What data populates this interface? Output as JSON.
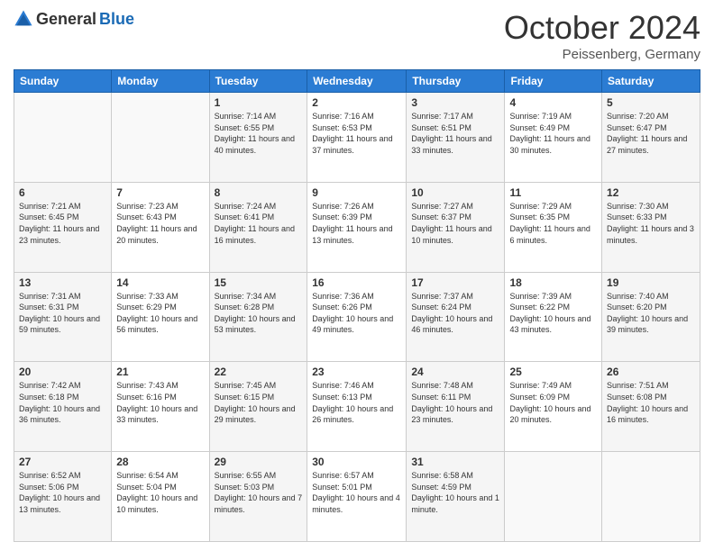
{
  "header": {
    "logo": {
      "general": "General",
      "blue": "Blue"
    },
    "title": "October 2024",
    "location": "Peissenberg, Germany"
  },
  "days_of_week": [
    "Sunday",
    "Monday",
    "Tuesday",
    "Wednesday",
    "Thursday",
    "Friday",
    "Saturday"
  ],
  "weeks": [
    [
      {
        "num": "",
        "sunrise": "",
        "sunset": "",
        "daylight": ""
      },
      {
        "num": "",
        "sunrise": "",
        "sunset": "",
        "daylight": ""
      },
      {
        "num": "1",
        "sunrise": "Sunrise: 7:14 AM",
        "sunset": "Sunset: 6:55 PM",
        "daylight": "Daylight: 11 hours and 40 minutes."
      },
      {
        "num": "2",
        "sunrise": "Sunrise: 7:16 AM",
        "sunset": "Sunset: 6:53 PM",
        "daylight": "Daylight: 11 hours and 37 minutes."
      },
      {
        "num": "3",
        "sunrise": "Sunrise: 7:17 AM",
        "sunset": "Sunset: 6:51 PM",
        "daylight": "Daylight: 11 hours and 33 minutes."
      },
      {
        "num": "4",
        "sunrise": "Sunrise: 7:19 AM",
        "sunset": "Sunset: 6:49 PM",
        "daylight": "Daylight: 11 hours and 30 minutes."
      },
      {
        "num": "5",
        "sunrise": "Sunrise: 7:20 AM",
        "sunset": "Sunset: 6:47 PM",
        "daylight": "Daylight: 11 hours and 27 minutes."
      }
    ],
    [
      {
        "num": "6",
        "sunrise": "Sunrise: 7:21 AM",
        "sunset": "Sunset: 6:45 PM",
        "daylight": "Daylight: 11 hours and 23 minutes."
      },
      {
        "num": "7",
        "sunrise": "Sunrise: 7:23 AM",
        "sunset": "Sunset: 6:43 PM",
        "daylight": "Daylight: 11 hours and 20 minutes."
      },
      {
        "num": "8",
        "sunrise": "Sunrise: 7:24 AM",
        "sunset": "Sunset: 6:41 PM",
        "daylight": "Daylight: 11 hours and 16 minutes."
      },
      {
        "num": "9",
        "sunrise": "Sunrise: 7:26 AM",
        "sunset": "Sunset: 6:39 PM",
        "daylight": "Daylight: 11 hours and 13 minutes."
      },
      {
        "num": "10",
        "sunrise": "Sunrise: 7:27 AM",
        "sunset": "Sunset: 6:37 PM",
        "daylight": "Daylight: 11 hours and 10 minutes."
      },
      {
        "num": "11",
        "sunrise": "Sunrise: 7:29 AM",
        "sunset": "Sunset: 6:35 PM",
        "daylight": "Daylight: 11 hours and 6 minutes."
      },
      {
        "num": "12",
        "sunrise": "Sunrise: 7:30 AM",
        "sunset": "Sunset: 6:33 PM",
        "daylight": "Daylight: 11 hours and 3 minutes."
      }
    ],
    [
      {
        "num": "13",
        "sunrise": "Sunrise: 7:31 AM",
        "sunset": "Sunset: 6:31 PM",
        "daylight": "Daylight: 10 hours and 59 minutes."
      },
      {
        "num": "14",
        "sunrise": "Sunrise: 7:33 AM",
        "sunset": "Sunset: 6:29 PM",
        "daylight": "Daylight: 10 hours and 56 minutes."
      },
      {
        "num": "15",
        "sunrise": "Sunrise: 7:34 AM",
        "sunset": "Sunset: 6:28 PM",
        "daylight": "Daylight: 10 hours and 53 minutes."
      },
      {
        "num": "16",
        "sunrise": "Sunrise: 7:36 AM",
        "sunset": "Sunset: 6:26 PM",
        "daylight": "Daylight: 10 hours and 49 minutes."
      },
      {
        "num": "17",
        "sunrise": "Sunrise: 7:37 AM",
        "sunset": "Sunset: 6:24 PM",
        "daylight": "Daylight: 10 hours and 46 minutes."
      },
      {
        "num": "18",
        "sunrise": "Sunrise: 7:39 AM",
        "sunset": "Sunset: 6:22 PM",
        "daylight": "Daylight: 10 hours and 43 minutes."
      },
      {
        "num": "19",
        "sunrise": "Sunrise: 7:40 AM",
        "sunset": "Sunset: 6:20 PM",
        "daylight": "Daylight: 10 hours and 39 minutes."
      }
    ],
    [
      {
        "num": "20",
        "sunrise": "Sunrise: 7:42 AM",
        "sunset": "Sunset: 6:18 PM",
        "daylight": "Daylight: 10 hours and 36 minutes."
      },
      {
        "num": "21",
        "sunrise": "Sunrise: 7:43 AM",
        "sunset": "Sunset: 6:16 PM",
        "daylight": "Daylight: 10 hours and 33 minutes."
      },
      {
        "num": "22",
        "sunrise": "Sunrise: 7:45 AM",
        "sunset": "Sunset: 6:15 PM",
        "daylight": "Daylight: 10 hours and 29 minutes."
      },
      {
        "num": "23",
        "sunrise": "Sunrise: 7:46 AM",
        "sunset": "Sunset: 6:13 PM",
        "daylight": "Daylight: 10 hours and 26 minutes."
      },
      {
        "num": "24",
        "sunrise": "Sunrise: 7:48 AM",
        "sunset": "Sunset: 6:11 PM",
        "daylight": "Daylight: 10 hours and 23 minutes."
      },
      {
        "num": "25",
        "sunrise": "Sunrise: 7:49 AM",
        "sunset": "Sunset: 6:09 PM",
        "daylight": "Daylight: 10 hours and 20 minutes."
      },
      {
        "num": "26",
        "sunrise": "Sunrise: 7:51 AM",
        "sunset": "Sunset: 6:08 PM",
        "daylight": "Daylight: 10 hours and 16 minutes."
      }
    ],
    [
      {
        "num": "27",
        "sunrise": "Sunrise: 6:52 AM",
        "sunset": "Sunset: 5:06 PM",
        "daylight": "Daylight: 10 hours and 13 minutes."
      },
      {
        "num": "28",
        "sunrise": "Sunrise: 6:54 AM",
        "sunset": "Sunset: 5:04 PM",
        "daylight": "Daylight: 10 hours and 10 minutes."
      },
      {
        "num": "29",
        "sunrise": "Sunrise: 6:55 AM",
        "sunset": "Sunset: 5:03 PM",
        "daylight": "Daylight: 10 hours and 7 minutes."
      },
      {
        "num": "30",
        "sunrise": "Sunrise: 6:57 AM",
        "sunset": "Sunset: 5:01 PM",
        "daylight": "Daylight: 10 hours and 4 minutes."
      },
      {
        "num": "31",
        "sunrise": "Sunrise: 6:58 AM",
        "sunset": "Sunset: 4:59 PM",
        "daylight": "Daylight: 10 hours and 1 minute."
      },
      {
        "num": "",
        "sunrise": "",
        "sunset": "",
        "daylight": ""
      },
      {
        "num": "",
        "sunrise": "",
        "sunset": "",
        "daylight": ""
      }
    ]
  ]
}
